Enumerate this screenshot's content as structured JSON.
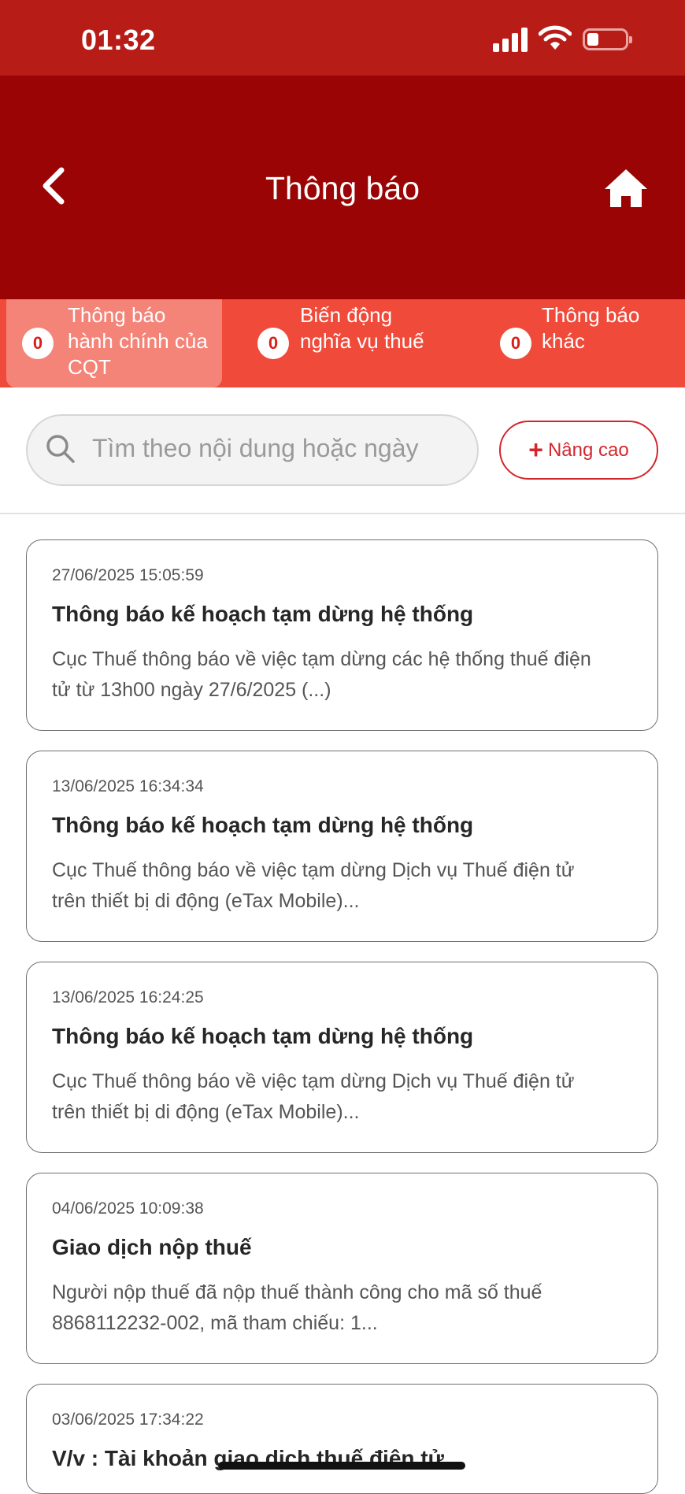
{
  "status_bar": {
    "time": "01:32"
  },
  "header": {
    "title": "Thông báo",
    "back_icon": "chevron-left-icon",
    "home_icon": "home-icon"
  },
  "tabs": [
    {
      "count": "0",
      "line1": "Thông báo",
      "line2": "hành chính của",
      "line3": "CQT",
      "active": true
    },
    {
      "count": "0",
      "line1": "Biến động",
      "line2": "nghĩa vụ thuế",
      "active": false
    },
    {
      "count": "0",
      "line1": "Thông báo",
      "line2": "khác",
      "active": false
    }
  ],
  "search": {
    "placeholder": "Tìm theo nội dung hoặc ngày"
  },
  "advanced_button": {
    "label": "Nâng cao"
  },
  "colors": {
    "header": "#9a0404",
    "status_bar": "#b71c17",
    "tabs": "#f04a3a",
    "tab_active": "#f48378",
    "accent": "#d3262c"
  },
  "notifications": [
    {
      "date": "27/06/2025 15:05:59",
      "title": "Thông báo kế hoạch tạm dừng hệ thống",
      "line1": "Cục Thuế thông báo về việc tạm dừng các hệ thống thuế điện",
      "line2": "tử từ 13h00 ngày 27/6/2025 (...)"
    },
    {
      "date": "13/06/2025 16:34:34",
      "title": "Thông báo kế hoạch tạm dừng hệ thống",
      "line1": "Cục Thuế thông báo về việc tạm dừng Dịch vụ Thuế điện tử",
      "line2": "trên thiết bị di động (eTax Mobile)..."
    },
    {
      "date": "13/06/2025 16:24:25",
      "title": "Thông báo kế hoạch tạm dừng hệ thống",
      "line1": "Cục Thuế thông báo về việc tạm dừng Dịch vụ Thuế điện tử",
      "line2": "trên thiết bị di động (eTax Mobile)..."
    },
    {
      "date": "04/06/2025 10:09:38",
      "title": "Giao dịch nộp thuế",
      "line1": "Người nộp thuế đã nộp thuế thành công cho mã số thuế",
      "line2": "8868112232-002, mã tham chiếu: 1..."
    },
    {
      "date": "03/06/2025 17:34:22",
      "title": "V/v : Tài khoản giao dịch thuế điện tử",
      "line1": "",
      "line2": ""
    }
  ]
}
